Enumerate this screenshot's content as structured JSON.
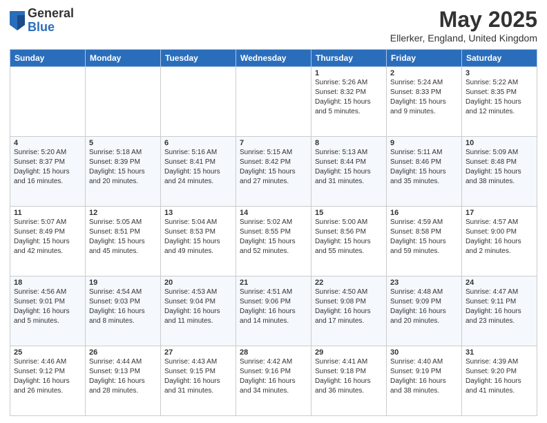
{
  "header": {
    "logo_general": "General",
    "logo_blue": "Blue",
    "title": "May 2025",
    "subtitle": "Ellerker, England, United Kingdom"
  },
  "columns": [
    "Sunday",
    "Monday",
    "Tuesday",
    "Wednesday",
    "Thursday",
    "Friday",
    "Saturday"
  ],
  "weeks": [
    [
      {
        "day": "",
        "info": ""
      },
      {
        "day": "",
        "info": ""
      },
      {
        "day": "",
        "info": ""
      },
      {
        "day": "",
        "info": ""
      },
      {
        "day": "1",
        "info": "Sunrise: 5:26 AM\nSunset: 8:32 PM\nDaylight: 15 hours\nand 5 minutes."
      },
      {
        "day": "2",
        "info": "Sunrise: 5:24 AM\nSunset: 8:33 PM\nDaylight: 15 hours\nand 9 minutes."
      },
      {
        "day": "3",
        "info": "Sunrise: 5:22 AM\nSunset: 8:35 PM\nDaylight: 15 hours\nand 12 minutes."
      }
    ],
    [
      {
        "day": "4",
        "info": "Sunrise: 5:20 AM\nSunset: 8:37 PM\nDaylight: 15 hours\nand 16 minutes."
      },
      {
        "day": "5",
        "info": "Sunrise: 5:18 AM\nSunset: 8:39 PM\nDaylight: 15 hours\nand 20 minutes."
      },
      {
        "day": "6",
        "info": "Sunrise: 5:16 AM\nSunset: 8:41 PM\nDaylight: 15 hours\nand 24 minutes."
      },
      {
        "day": "7",
        "info": "Sunrise: 5:15 AM\nSunset: 8:42 PM\nDaylight: 15 hours\nand 27 minutes."
      },
      {
        "day": "8",
        "info": "Sunrise: 5:13 AM\nSunset: 8:44 PM\nDaylight: 15 hours\nand 31 minutes."
      },
      {
        "day": "9",
        "info": "Sunrise: 5:11 AM\nSunset: 8:46 PM\nDaylight: 15 hours\nand 35 minutes."
      },
      {
        "day": "10",
        "info": "Sunrise: 5:09 AM\nSunset: 8:48 PM\nDaylight: 15 hours\nand 38 minutes."
      }
    ],
    [
      {
        "day": "11",
        "info": "Sunrise: 5:07 AM\nSunset: 8:49 PM\nDaylight: 15 hours\nand 42 minutes."
      },
      {
        "day": "12",
        "info": "Sunrise: 5:05 AM\nSunset: 8:51 PM\nDaylight: 15 hours\nand 45 minutes."
      },
      {
        "day": "13",
        "info": "Sunrise: 5:04 AM\nSunset: 8:53 PM\nDaylight: 15 hours\nand 49 minutes."
      },
      {
        "day": "14",
        "info": "Sunrise: 5:02 AM\nSunset: 8:55 PM\nDaylight: 15 hours\nand 52 minutes."
      },
      {
        "day": "15",
        "info": "Sunrise: 5:00 AM\nSunset: 8:56 PM\nDaylight: 15 hours\nand 55 minutes."
      },
      {
        "day": "16",
        "info": "Sunrise: 4:59 AM\nSunset: 8:58 PM\nDaylight: 15 hours\nand 59 minutes."
      },
      {
        "day": "17",
        "info": "Sunrise: 4:57 AM\nSunset: 9:00 PM\nDaylight: 16 hours\nand 2 minutes."
      }
    ],
    [
      {
        "day": "18",
        "info": "Sunrise: 4:56 AM\nSunset: 9:01 PM\nDaylight: 16 hours\nand 5 minutes."
      },
      {
        "day": "19",
        "info": "Sunrise: 4:54 AM\nSunset: 9:03 PM\nDaylight: 16 hours\nand 8 minutes."
      },
      {
        "day": "20",
        "info": "Sunrise: 4:53 AM\nSunset: 9:04 PM\nDaylight: 16 hours\nand 11 minutes."
      },
      {
        "day": "21",
        "info": "Sunrise: 4:51 AM\nSunset: 9:06 PM\nDaylight: 16 hours\nand 14 minutes."
      },
      {
        "day": "22",
        "info": "Sunrise: 4:50 AM\nSunset: 9:08 PM\nDaylight: 16 hours\nand 17 minutes."
      },
      {
        "day": "23",
        "info": "Sunrise: 4:48 AM\nSunset: 9:09 PM\nDaylight: 16 hours\nand 20 minutes."
      },
      {
        "day": "24",
        "info": "Sunrise: 4:47 AM\nSunset: 9:11 PM\nDaylight: 16 hours\nand 23 minutes."
      }
    ],
    [
      {
        "day": "25",
        "info": "Sunrise: 4:46 AM\nSunset: 9:12 PM\nDaylight: 16 hours\nand 26 minutes."
      },
      {
        "day": "26",
        "info": "Sunrise: 4:44 AM\nSunset: 9:13 PM\nDaylight: 16 hours\nand 28 minutes."
      },
      {
        "day": "27",
        "info": "Sunrise: 4:43 AM\nSunset: 9:15 PM\nDaylight: 16 hours\nand 31 minutes."
      },
      {
        "day": "28",
        "info": "Sunrise: 4:42 AM\nSunset: 9:16 PM\nDaylight: 16 hours\nand 34 minutes."
      },
      {
        "day": "29",
        "info": "Sunrise: 4:41 AM\nSunset: 9:18 PM\nDaylight: 16 hours\nand 36 minutes."
      },
      {
        "day": "30",
        "info": "Sunrise: 4:40 AM\nSunset: 9:19 PM\nDaylight: 16 hours\nand 38 minutes."
      },
      {
        "day": "31",
        "info": "Sunrise: 4:39 AM\nSunset: 9:20 PM\nDaylight: 16 hours\nand 41 minutes."
      }
    ]
  ]
}
